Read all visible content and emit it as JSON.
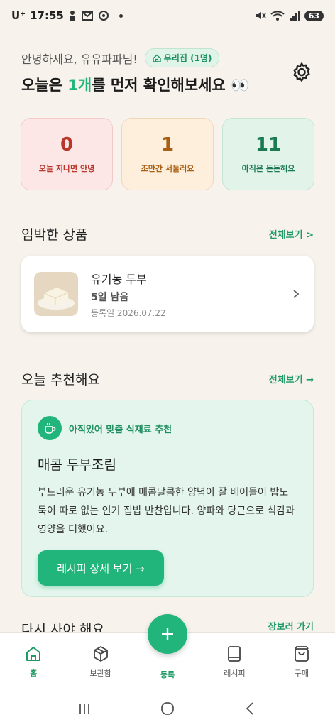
{
  "status": {
    "carrier": "U⁺",
    "time": "17:55",
    "battery": "63"
  },
  "header": {
    "greeting": "안녕하세요, 유유파파님!",
    "home_chip": "우리집 (1명)",
    "headline_pre": "오늘은 ",
    "headline_accent": "1개",
    "headline_post": "를 먼저 확인해보세요 👀"
  },
  "stats": [
    {
      "value": "0",
      "label": "오늘 지나면 안녕"
    },
    {
      "value": "1",
      "label": "조만간 서둘러요"
    },
    {
      "value": "11",
      "label": "아직은 든든해요"
    }
  ],
  "imminent": {
    "title": "임박한 상품",
    "more": "전체보기 >",
    "item": {
      "name": "유기농 두부",
      "days_left": "5일 남음",
      "registered": "등록일 2026.07.22"
    }
  },
  "recommend": {
    "title": "오늘 추천해요",
    "more": "전체보기 →",
    "tag": "아직있어 맞춤 식재료 추천",
    "recipe_title": "매콤 두부조림",
    "description": "부드러운 유기농 두부에 매콤달콤한 양념이 잘 배어들어 밥도둑이 따로 없는 인기 집밥 반찬입니다. 양파와 당근으로 식감과 영양을 더했어요.",
    "button": "레시피 상세 보기 →"
  },
  "peek_section": {
    "title": "다시 사야 해요",
    "more": "장보러 가기"
  },
  "nav": {
    "home": "홈",
    "storage": "보관함",
    "register": "등록",
    "recipe": "레시피",
    "purchase": "구매"
  },
  "colors": {
    "accent": "#21b57c",
    "background": "#f7f3ec"
  }
}
